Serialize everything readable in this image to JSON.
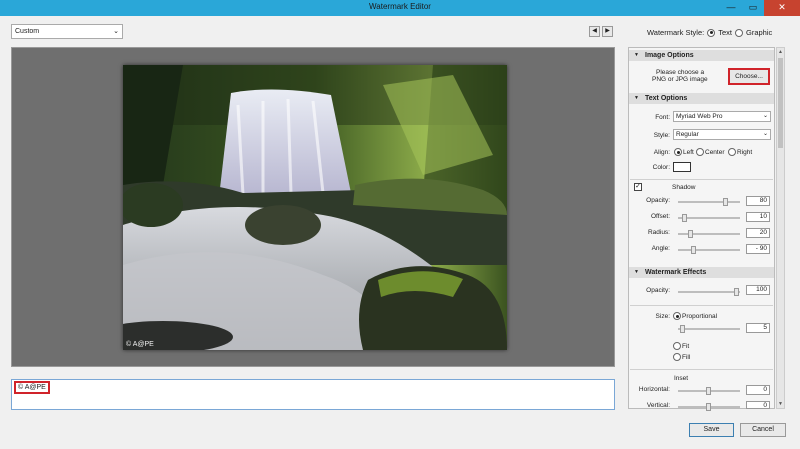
{
  "window": {
    "title": "Watermark Editor",
    "minimize": "—",
    "maximize": "▭",
    "close": "✕"
  },
  "toolbar": {
    "preset": "Custom",
    "prev": "◀",
    "next": "▶"
  },
  "watermark_style": {
    "label": "Watermark Style:",
    "options": [
      "Text",
      "Graphic"
    ],
    "selected": "Text"
  },
  "preview": {
    "watermark_text": "© A@PE"
  },
  "text_entry": {
    "value": "© A@PE"
  },
  "image_options": {
    "header": "Image Options",
    "prompt_line1": "Please choose a",
    "prompt_line2": "PNG or JPG image",
    "choose_label": "Choose..."
  },
  "text_options": {
    "header": "Text Options",
    "font_label": "Font:",
    "font_value": "Myriad Web Pro",
    "style_label": "Style:",
    "style_value": "Regular",
    "align_label": "Align:",
    "align_options": [
      "Left",
      "Center",
      "Right"
    ],
    "align_selected": "Left",
    "color_label": "Color:",
    "color_value": "#ffffff",
    "shadow": {
      "label": "Shadow",
      "enabled": true,
      "opacity_label": "Opacity:",
      "opacity": "80",
      "offset_label": "Offset:",
      "offset": "10",
      "radius_label": "Radius:",
      "radius": "20",
      "angle_label": "Angle:",
      "angle": "- 90"
    }
  },
  "watermark_effects": {
    "header": "Watermark Effects",
    "opacity_label": "Opacity:",
    "opacity": "100",
    "size_label": "Size:",
    "size_options": [
      "Proportional",
      "Fit",
      "Fill"
    ],
    "size_selected": "Proportional",
    "size_value": "5",
    "inset_label": "Inset",
    "horizontal_label": "Horizontal:",
    "horizontal": "0",
    "vertical_label": "Vertical:",
    "vertical": "0"
  },
  "footer": {
    "save_label": "Save",
    "cancel_label": "Cancel"
  },
  "colors": {
    "titlebar": "#2aa7d8",
    "close": "#c7432f",
    "highlight": "#d0232a"
  }
}
